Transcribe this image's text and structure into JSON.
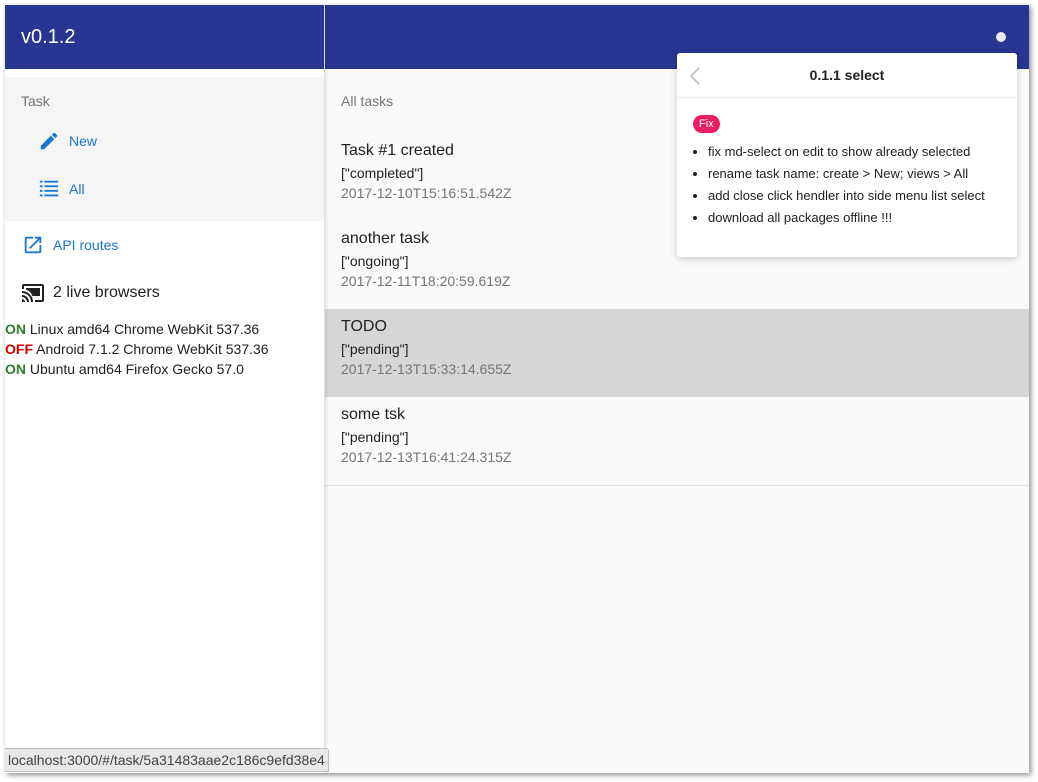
{
  "app": {
    "version": "v0.1.2"
  },
  "sidebar": {
    "task_subheader": "Task",
    "items": [
      {
        "label": "New",
        "icon": "pencil-icon"
      },
      {
        "label": "All",
        "icon": "list-icon"
      }
    ],
    "api_routes_label": "API routes",
    "live_browsers_label": "2 live browsers",
    "browsers": [
      {
        "status": "ON",
        "name": "Linux amd64 Chrome WebKit 537.36"
      },
      {
        "status": "OFF",
        "name": "Android 7.1.2 Chrome WebKit 537.36"
      },
      {
        "status": "ON",
        "name": "Ubuntu amd64 Firefox Gecko 57.0"
      }
    ]
  },
  "main": {
    "subheader": "All tasks",
    "tasks": [
      {
        "title": "Task #1 created",
        "tags": "[\"completed\"]",
        "date": "2017-12-10T15:16:51.542Z"
      },
      {
        "title": "another task",
        "tags": "[\"ongoing\"]",
        "date": "2017-12-11T18:20:59.619Z"
      },
      {
        "title": "TODO",
        "tags": "[\"pending\"]",
        "date": "2017-12-13T15:33:14.655Z"
      },
      {
        "title": "some tsk",
        "tags": "[\"pending\"]",
        "date": "2017-12-13T16:41:24.315Z"
      }
    ]
  },
  "popover": {
    "title": "0.1.1 select",
    "badge": "Fix",
    "notes": [
      "fix md-select on edit to show already selected",
      "rename task name: create > New; views > All",
      "add close click hendler into side menu list select",
      "download all packages offline !!!"
    ]
  },
  "statusbar": {
    "url": "localhost:3000/#/task/5a31483aae2c186c9efd38e4"
  },
  "colors": {
    "primary": "#283593",
    "link": "#1976d2",
    "on": "#2e7d32",
    "off": "#d50000",
    "badge": "#e91e63",
    "selected_row": "#d6d6d6"
  }
}
